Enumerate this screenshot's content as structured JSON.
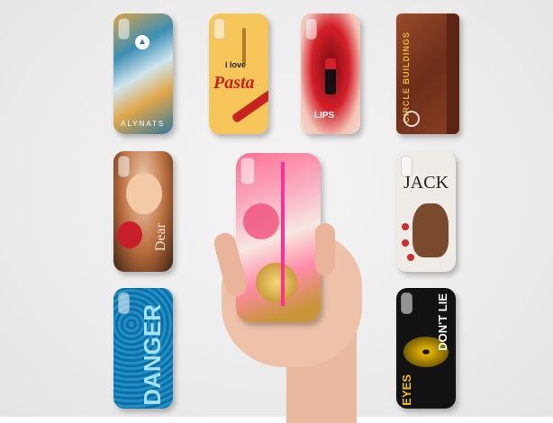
{
  "cases": {
    "marble": {
      "brand": "ALYNATS"
    },
    "pasta": {
      "line1": "i love",
      "line2": "Pasta"
    },
    "lips": {
      "label": "LIPS"
    },
    "leather": {
      "label": "CIRCLE BUILDINGS"
    },
    "baby": {
      "label": "Dear"
    },
    "dog": {
      "label": "JACK"
    },
    "blue": {
      "label": "DANGER"
    },
    "eyes": {
      "line1": "EYES",
      "line2": "DON'T LIE"
    }
  },
  "colors": {
    "background": "#ececec",
    "skin": "#e9b9a0",
    "pasta_bg": "#f7c65a",
    "pasta_text": "#c8231f",
    "lips_red": "#d3202a",
    "leather": "#7b3a22",
    "eyes_yellow": "#f2c200"
  }
}
